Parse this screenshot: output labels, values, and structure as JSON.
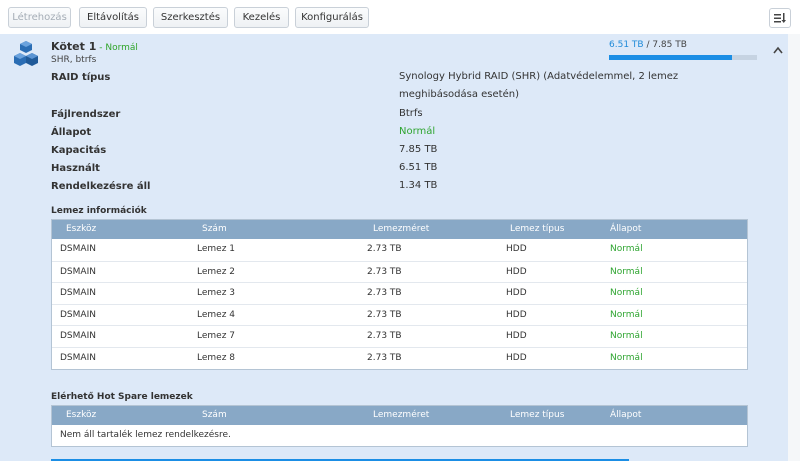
{
  "toolbar": {
    "buttons": [
      {
        "label": "Létrehozás",
        "disabled": true
      },
      {
        "label": "Eltávolítás",
        "disabled": false
      },
      {
        "label": "Szerkesztés",
        "disabled": false
      },
      {
        "label": "Kezelés",
        "disabled": false
      },
      {
        "label": "Konfigurálás",
        "disabled": false
      }
    ],
    "view_icon": "sort-list-icon"
  },
  "volume": {
    "icon": "cubes-icon",
    "name": "Kötet 1",
    "status_separator": " - ",
    "status": "Normál",
    "subtitle": "SHR, btrfs",
    "usage_used": "6.51 TB",
    "usage_sep": " / ",
    "usage_total": "7.85 TB",
    "usage_fraction": 0.83,
    "collapse_icon": "chevron-up-icon",
    "properties": [
      {
        "label": "RAID típus",
        "value": "Synology Hybrid RAID (SHR) (Adatvédelemmel, 2 lemez meghibásodása esetén)"
      },
      {
        "label": "Fájlrendszer",
        "value": "Btrfs"
      },
      {
        "label": "Állapot",
        "value": "Normál"
      },
      {
        "label": "Kapacitás",
        "value": "7.85 TB"
      },
      {
        "label": "Használt",
        "value": "6.51 TB"
      },
      {
        "label": "Rendelkezésre áll",
        "value": "1.34 TB"
      }
    ]
  },
  "disk_info": {
    "title": "Lemez információk",
    "columns": [
      "Eszköz",
      "Szám",
      "Lemezméret",
      "Lemez típus",
      "Állapot"
    ],
    "rows": [
      [
        "DSMAIN",
        "Lemez 1",
        "2.73 TB",
        "HDD",
        "Normál"
      ],
      [
        "DSMAIN",
        "Lemez 2",
        "2.73 TB",
        "HDD",
        "Normál"
      ],
      [
        "DSMAIN",
        "Lemez 3",
        "2.73 TB",
        "HDD",
        "Normál"
      ],
      [
        "DSMAIN",
        "Lemez 4",
        "2.73 TB",
        "HDD",
        "Normál"
      ],
      [
        "DSMAIN",
        "Lemez 7",
        "2.73 TB",
        "HDD",
        "Normál"
      ],
      [
        "DSMAIN",
        "Lemez 8",
        "2.73 TB",
        "HDD",
        "Normál"
      ]
    ]
  },
  "hot_spare": {
    "title": "Elérhető Hot Spare lemezek",
    "columns": [
      "Eszköz",
      "Szám",
      "Lemezméret",
      "Lemez típus",
      "Állapot"
    ],
    "empty_text": "Nem áll tartalék lemez rendelkezésre."
  },
  "colors": {
    "status_green": "#2fa531",
    "accent_blue": "#1b8ee5",
    "panel_bg": "#dde9f8",
    "table_header": "#88a8c6"
  }
}
